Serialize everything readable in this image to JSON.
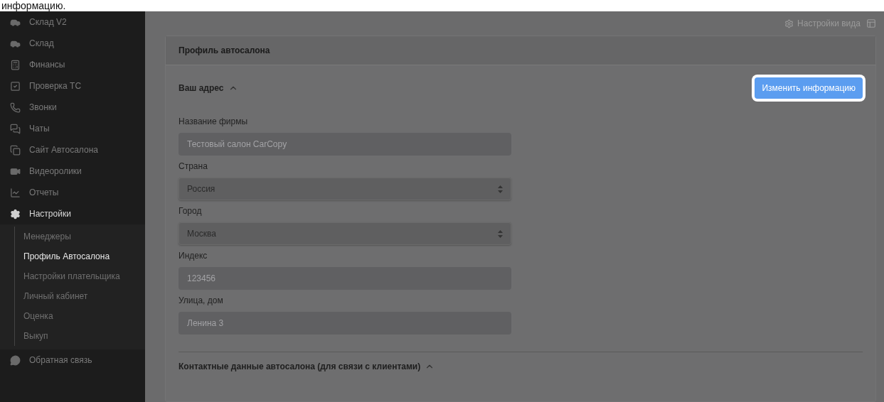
{
  "caption": "информацию.",
  "sidebar": {
    "items": [
      {
        "label": "Склад V2",
        "expanded": false
      },
      {
        "label": "Склад",
        "expanded": false
      },
      {
        "label": "Финансы",
        "expanded": false
      },
      {
        "label": "Проверка ТС",
        "expanded": false
      },
      {
        "label": "Звонки",
        "expanded": false
      },
      {
        "label": "Чаты",
        "expanded": false
      },
      {
        "label": "Сайт Автосалона",
        "expanded": false
      },
      {
        "label": "Видеоролики",
        "expanded": false
      },
      {
        "label": "Отчеты",
        "expanded": false
      },
      {
        "label": "Настройки",
        "expanded": true,
        "children": [
          {
            "label": "Менеджеры",
            "selected": false
          },
          {
            "label": "Профиль Автосалона",
            "selected": true
          },
          {
            "label": "Настройки плательщика",
            "selected": false
          },
          {
            "label": "Личный кабинет",
            "selected": false
          },
          {
            "label": "Оценка",
            "selected": false
          },
          {
            "label": "Выкуп",
            "selected": false
          }
        ]
      },
      {
        "label": "Обратная связь",
        "expanded": false
      }
    ]
  },
  "topbar": {
    "view_settings": "Настройки вида"
  },
  "card": {
    "title": "Профиль автосалона",
    "sections": [
      {
        "title": "Ваш адрес",
        "expanded": true,
        "action": {
          "label": "Изменить информацию",
          "highlighted": true
        },
        "fields": [
          {
            "kind": "input",
            "label": "Название фирмы",
            "value": "Тестовый салон CarCopy",
            "disabled": true
          },
          {
            "kind": "select",
            "label": "Страна",
            "value": "Россия",
            "disabled": false
          },
          {
            "kind": "select",
            "label": "Город",
            "value": "Москва",
            "disabled": false
          },
          {
            "kind": "input",
            "label": "Индекс",
            "value": "123456",
            "disabled": true
          },
          {
            "kind": "input",
            "label": "Улица, дом",
            "value": "Ленина 3",
            "disabled": true
          }
        ]
      },
      {
        "title": "Контактные данные автосалона (для связи с клиентами)",
        "expanded": true
      }
    ]
  }
}
